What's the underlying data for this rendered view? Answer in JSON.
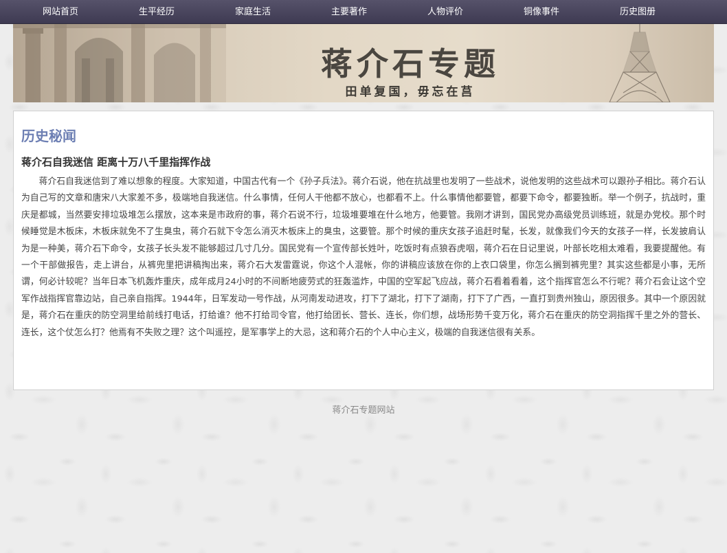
{
  "nav": {
    "items": [
      {
        "label": "网站首页"
      },
      {
        "label": "生平经历"
      },
      {
        "label": "家庭生活"
      },
      {
        "label": "主要著作"
      },
      {
        "label": "人物评价"
      },
      {
        "label": "铜像事件"
      },
      {
        "label": "历史图册"
      }
    ]
  },
  "banner": {
    "title": "蒋介石专题",
    "subtitle": "田单复国，毋忘在莒"
  },
  "main": {
    "section_title": "历史秘闻",
    "article_title": "蒋介石自我迷信 距离十万八千里指挥作战",
    "article_body": "蒋介石自我迷信到了难以想象的程度。大家知道，中国古代有一个《孙子兵法》。蒋介石说，他在抗战里也发明了一些战术，说他发明的这些战术可以跟孙子相比。蒋介石认为自己写的文章和唐宋八大家差不多，极端地自我迷信。什么事情，任何人干他都不放心，也都看不上。什么事情他都要管，都要下命令，都要独断。举一个例子，抗战时，重庆是都城，当然要安排垃圾堆怎么摆放，这本来是市政府的事，蒋介石说不行，垃圾堆要堆在什么地方，他要管。我刚才讲到，国民党办高级党员训练班，就是办党校。那个时候睡觉是木板床，木板床就免不了生臭虫，蒋介石就下令怎么消灭木板床上的臭虫，这要管。那个时候的重庆女孩子追赶时髦，长发，就像我们今天的女孩子一样，长发披肩认为是一种美，蒋介石下命令，女孩子长头发不能够超过几寸几分。国民党有一个宣传部长姓叶，吃饭时有点狼吞虎咽，蒋介石在日记里说，叶部长吃相太难看，我要提醒他。有一个干部做报告，走上讲台，从裤兜里把讲稿掏出来，蒋介石大发雷霆说，你这个人混帐，你的讲稿应该放在你的上衣口袋里，你怎么搁到裤兜里？其实这些都是小事，无所谓，何必计较呢？当年日本飞机轰炸重庆，成年成月24小时的不间断地疲劳式的狂轰滥炸，中国的空军起飞应战，蒋介石看着看着，这个指挥官怎么不行呢？蒋介石会让这个空军作战指挥官靠边站，自己亲自指挥。1944年，日军发动一号作战，从河南发动进攻，打下了湖北，打下了湖南，打下了广西，一直打到贵州独山，原因很多。其中一个原因就是，蒋介石在重庆的防空洞里给前线打电话，打给谁？他不打给司令官，他打给团长、营长、连长，你们想，战场形势千变万化，蒋介石在重庆的防空洞指挥千里之外的营长、连长，这个仗怎么打？他焉有不失败之理？这个叫遥控，是军事学上的大忌，这和蒋介石的个人中心主义，极端的自我迷信很有关系。"
  },
  "footer": {
    "text": "蒋介石专题网站"
  }
}
